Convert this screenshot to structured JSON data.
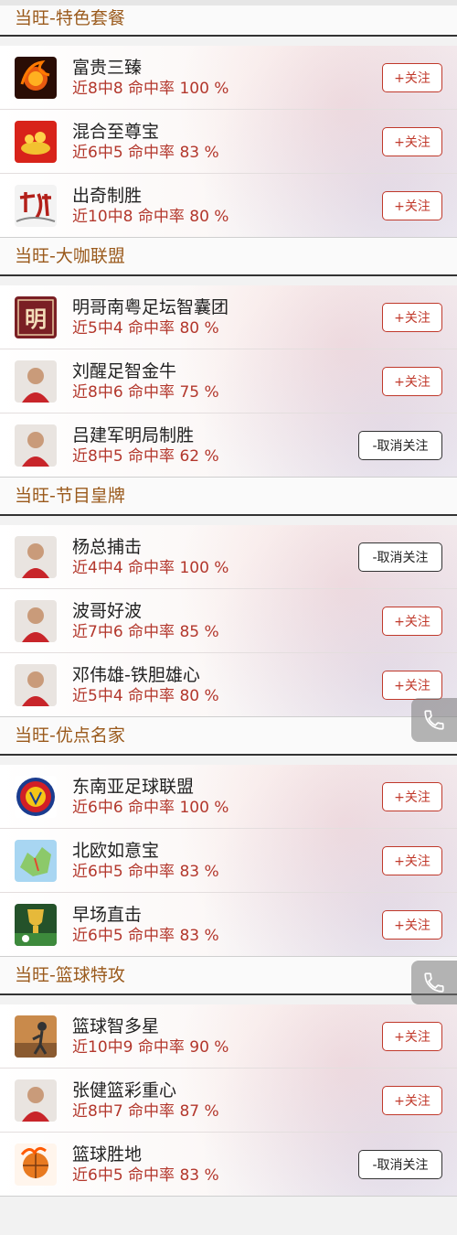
{
  "follow_label": "+关注",
  "unfollow_label": "-取消关注",
  "sections": [
    {
      "title": "当旺-特色套餐",
      "items": [
        {
          "name": "富贵三臻",
          "stats": "近8中8 命中率 100 %",
          "followed": false,
          "icon": "fire-football-icon"
        },
        {
          "name": "混合至尊宝",
          "stats": "近6中5 命中率 83 %",
          "followed": false,
          "icon": "treasure-icon"
        },
        {
          "name": "出奇制胜",
          "stats": "近10中8 命中率 80 %",
          "followed": false,
          "icon": "calligraphy-icon"
        }
      ]
    },
    {
      "title": "当旺-大咖联盟",
      "items": [
        {
          "name": "明哥南粤足坛智囊团",
          "stats": "近5中4 命中率 80 %",
          "followed": false,
          "icon": "ming-logo-icon",
          "logo_text": "明"
        },
        {
          "name": "刘醒足智金牛",
          "stats": "近8中6 命中率 75 %",
          "followed": false,
          "icon": "person-avatar-icon"
        },
        {
          "name": "吕建军明局制胜",
          "stats": "近8中5 命中率 62 %",
          "followed": true,
          "icon": "person-avatar-icon"
        }
      ]
    },
    {
      "title": "当旺-节目皇牌",
      "items": [
        {
          "name": "杨总捕击",
          "stats": "近4中4 命中率 100 %",
          "followed": true,
          "icon": "person-avatar-icon"
        },
        {
          "name": "波哥好波",
          "stats": "近7中6 命中率 85 %",
          "followed": false,
          "icon": "person-avatar-icon"
        },
        {
          "name": "邓伟雄-铁胆雄心",
          "stats": "近5中4 命中率 80 %",
          "followed": false,
          "icon": "person-avatar-icon"
        }
      ]
    },
    {
      "title": "当旺-优点名家",
      "items": [
        {
          "name": "东南亚足球联盟",
          "stats": "近6中6 命中率 100 %",
          "followed": false,
          "icon": "asean-logo-icon"
        },
        {
          "name": "北欧如意宝",
          "stats": "近6中5 命中率 83 %",
          "followed": false,
          "icon": "map-icon"
        },
        {
          "name": "早场直击",
          "stats": "近6中5 命中率 83 %",
          "followed": false,
          "icon": "trophy-icon"
        }
      ]
    },
    {
      "title": "当旺-篮球特攻",
      "items": [
        {
          "name": "篮球智多星",
          "stats": "近10中9 命中率 90 %",
          "followed": false,
          "icon": "basketball-court-icon"
        },
        {
          "name": "张健篮彩重心",
          "stats": "近8中7 命中率 87 %",
          "followed": false,
          "icon": "person-avatar-icon"
        },
        {
          "name": "篮球胜地",
          "stats": "近6中5 命中率 83 %",
          "followed": true,
          "icon": "basketball-fire-icon"
        }
      ]
    }
  ]
}
